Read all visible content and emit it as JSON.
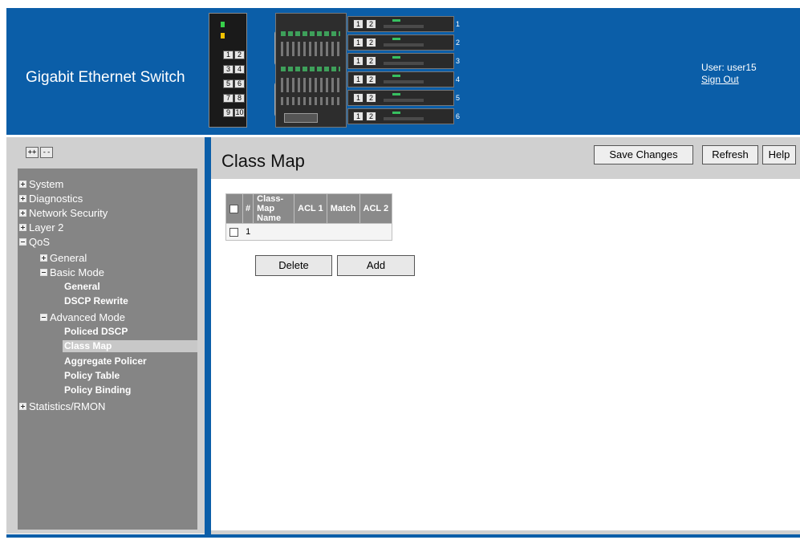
{
  "header": {
    "app_title": "Gigabit Ethernet Switch",
    "user_label": "User:",
    "user_name": "user15",
    "sign_out": "Sign Out",
    "unit_a_ports": [
      "1",
      "2",
      "3",
      "4",
      "5",
      "6",
      "7",
      "8",
      "9",
      "10"
    ],
    "stack_units": [
      {
        "port1": "1",
        "port2": "2",
        "num": "1"
      },
      {
        "port1": "1",
        "port2": "2",
        "num": "2"
      },
      {
        "port1": "1",
        "port2": "2",
        "num": "3"
      },
      {
        "port1": "1",
        "port2": "2",
        "num": "4"
      },
      {
        "port1": "1",
        "port2": "2",
        "num": "5"
      },
      {
        "port1": "1",
        "port2": "2",
        "num": "6"
      }
    ]
  },
  "sidebar": {
    "expand_all": "++",
    "collapse_all": "--",
    "items": [
      {
        "label": "System",
        "type": "plus"
      },
      {
        "label": "Diagnostics",
        "type": "plus"
      },
      {
        "label": "Network Security",
        "type": "plus"
      },
      {
        "label": "Layer 2",
        "type": "plus"
      },
      {
        "label": "QoS",
        "type": "minus"
      },
      {
        "label": "General",
        "type": "plus"
      },
      {
        "label": "Basic Mode",
        "type": "minus"
      },
      {
        "label": "General",
        "type": "leaf"
      },
      {
        "label": "DSCP Rewrite",
        "type": "leaf"
      },
      {
        "label": "Advanced Mode",
        "type": "minus"
      },
      {
        "label": "Policed DSCP",
        "type": "leaf"
      },
      {
        "label": "Class Map",
        "type": "leaf",
        "active": true
      },
      {
        "label": "Aggregate Policer",
        "type": "leaf"
      },
      {
        "label": "Policy Table",
        "type": "leaf"
      },
      {
        "label": "Policy Binding",
        "type": "leaf"
      },
      {
        "label": "Statistics/RMON",
        "type": "plus"
      }
    ]
  },
  "main": {
    "title": "Class Map",
    "buttons": {
      "save": "Save Changes",
      "refresh": "Refresh",
      "help": "Help"
    },
    "table": {
      "headers": [
        "#",
        "Class-Map Name",
        "ACL 1",
        "Match",
        "ACL 2"
      ],
      "rows": [
        [
          "1",
          "",
          "",
          "",
          ""
        ]
      ]
    },
    "actions": {
      "delete": "Delete",
      "add": "Add"
    }
  },
  "colors": {
    "header_blue": "#0b5ea8",
    "panel_grey": "#d0d0d0",
    "tree_grey": "#858585",
    "table_header": "#8a8a8a"
  }
}
